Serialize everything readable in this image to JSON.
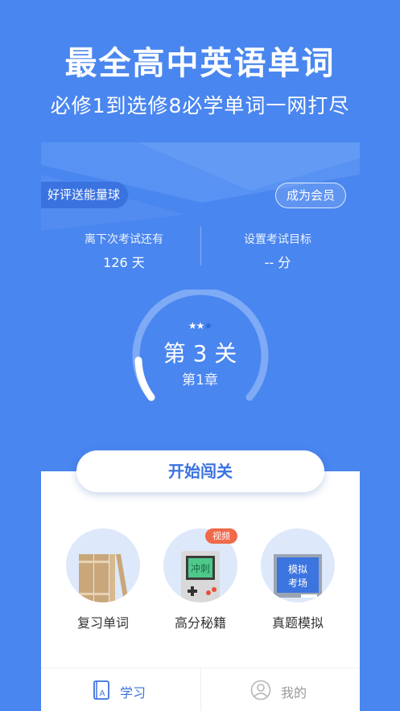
{
  "hero": {
    "title": "最全高中英语单词",
    "subtitle": "必修1到选修8必学单词一网打尽"
  },
  "status": {
    "review_badge": "好评送能量球",
    "member_button": "成为会员",
    "exam_countdown_label": "离下次考试还有",
    "exam_countdown_value": "126 天",
    "target_label": "设置考试目标",
    "target_value": "-- 分"
  },
  "progress": {
    "stars_filled": 2,
    "stars_total": 3,
    "level": "第 3 关",
    "chapter": "第1章"
  },
  "start_button": "开始闯关",
  "features": [
    {
      "label": "复习单词",
      "icon": "books-icon"
    },
    {
      "label": "高分秘籍",
      "icon": "game-console-icon",
      "badge": "视频",
      "screen_text": "冲刺"
    },
    {
      "label": "真题模拟",
      "icon": "chalkboard-icon",
      "board_text_1": "模拟",
      "board_text_2": "考场"
    }
  ],
  "tabs": [
    {
      "label": "学习",
      "icon": "book-a-icon",
      "active": true
    },
    {
      "label": "我的",
      "icon": "user-icon",
      "active": false
    }
  ],
  "colors": {
    "background": "#4a86ef",
    "accent": "#3a72e0",
    "video_badge": "#f06a4a"
  }
}
